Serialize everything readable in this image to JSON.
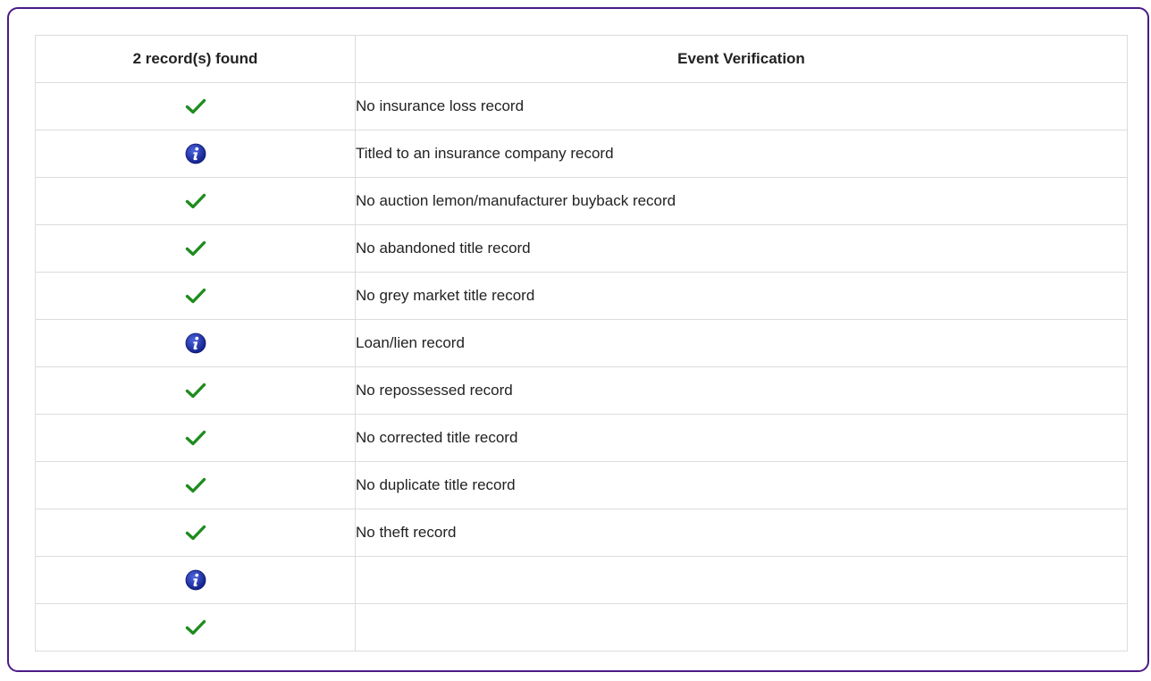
{
  "table": {
    "header_status": "2 record(s) found",
    "header_event": "Event Verification",
    "rows": [
      {
        "status": "check",
        "event": "No insurance loss record"
      },
      {
        "status": "info",
        "event": "Titled to an insurance company record"
      },
      {
        "status": "check",
        "event": "No auction lemon/manufacturer buyback record"
      },
      {
        "status": "check",
        "event": "No abandoned title record"
      },
      {
        "status": "check",
        "event": "No grey market title record"
      },
      {
        "status": "info",
        "event": "Loan/lien record"
      },
      {
        "status": "check",
        "event": "No repossessed record"
      },
      {
        "status": "check",
        "event": "No corrected title record"
      },
      {
        "status": "check",
        "event": "No duplicate title record"
      },
      {
        "status": "check",
        "event": "No theft record"
      },
      {
        "status": "info",
        "event": ""
      },
      {
        "status": "check",
        "event": ""
      }
    ]
  },
  "icons": {
    "check": "check-icon",
    "info": "info-icon"
  },
  "colors": {
    "panel_border": "#4b1a86",
    "check": "#1e8c1e",
    "info": "#1a2d9c",
    "grid": "#dcdcdc"
  }
}
